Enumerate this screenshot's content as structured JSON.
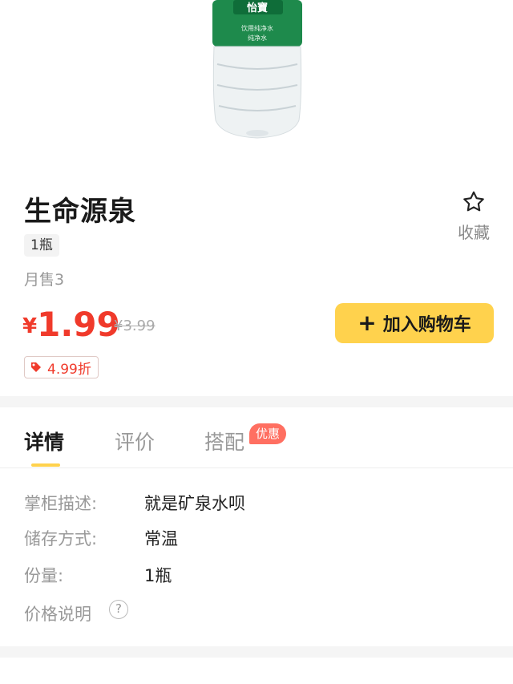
{
  "product": {
    "name": "生命源泉",
    "spec": "1瓶",
    "sales": "月售3",
    "currency": "¥",
    "price": "1.99",
    "original_price": "¥3.99",
    "discount": "4.99折"
  },
  "favorite": {
    "label": "收藏",
    "icon": "star-outline-icon"
  },
  "cart_button": {
    "icon": "plus",
    "label": "加入购物车"
  },
  "tabs": [
    {
      "label": "详情",
      "active": true
    },
    {
      "label": "评价",
      "active": false
    },
    {
      "label": "搭配",
      "active": false,
      "badge": "优惠"
    }
  ],
  "details": [
    {
      "key": "掌柜描述:",
      "value": "就是矿泉水呗"
    },
    {
      "key": "储存方式:",
      "value": "常温"
    },
    {
      "key": "份量:",
      "value": "1瓶"
    },
    {
      "key": "价格说明",
      "value": ""
    }
  ],
  "bottle_label": {
    "brand": "怡寶",
    "line1": "饮用纯净水",
    "line2": "纯净水"
  },
  "colors": {
    "accent_yellow": "#ffd24d",
    "price_red": "#f03a2b",
    "badge_red": "#ff6f61",
    "bottle_green": "#1e8a4c"
  }
}
